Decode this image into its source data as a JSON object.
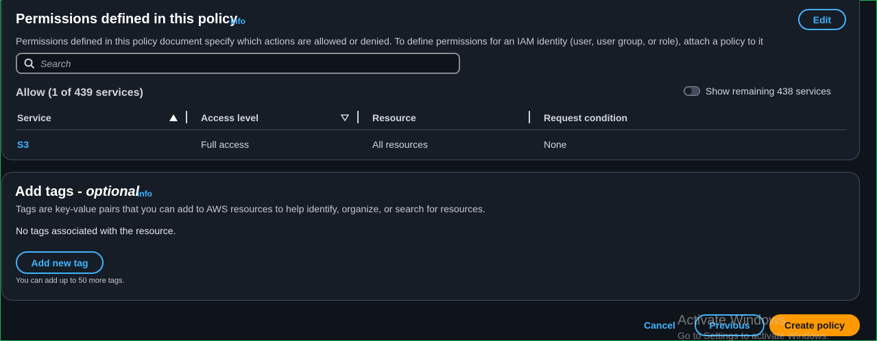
{
  "permissions": {
    "title": "Permissions defined in this policy",
    "info": "Info",
    "edit": "Edit",
    "description": "Permissions defined in this policy document specify which actions are allowed or denied. To define permissions for an IAM identity (user, user group, or role), attach a policy to it",
    "search_placeholder": "Search",
    "allow_heading": "Allow (1 of 439 services)",
    "toggle_label": "Show remaining 438 services",
    "columns": [
      "Service",
      "Access level",
      "Resource",
      "Request condition"
    ],
    "rows": [
      {
        "service": "S3",
        "access": "Full access",
        "resource": "All resources",
        "condition": "None"
      }
    ]
  },
  "tags": {
    "title_main": "Add tags - ",
    "title_optional": "optional",
    "info": "Info",
    "description": "Tags are key-value pairs that you can add to AWS resources to help identify, organize, or search for resources.",
    "empty": "No tags associated with the resource.",
    "add_button": "Add new tag",
    "limit_note": "You can add up to 50 more tags."
  },
  "footer": {
    "cancel": "Cancel",
    "previous": "Previous",
    "create": "Create policy"
  },
  "watermark": {
    "line1": "Activate Windows",
    "line2": "Go to Settings to activate Windows."
  }
}
